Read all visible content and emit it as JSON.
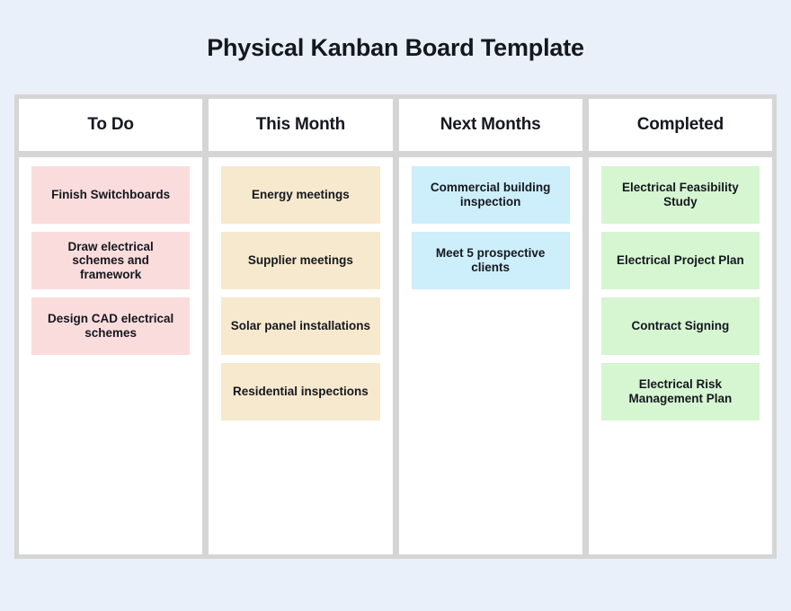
{
  "page": {
    "background_color": "#eaf0fa",
    "title": "Physical Kanban Board Template"
  },
  "board": {
    "frame_color": "#d5d5d5",
    "panel_color": "#ffffff",
    "columns": [
      {
        "header": "To Do",
        "card_color": "#fbdcdc",
        "cards": [
          {
            "label": "Finish Switchboards"
          },
          {
            "label": "Draw electrical schemes and framework"
          },
          {
            "label": "Design CAD electrical schemes"
          }
        ]
      },
      {
        "header": "This Month",
        "card_color": "#f7e9cd",
        "cards": [
          {
            "label": "Energy meetings"
          },
          {
            "label": "Supplier meetings"
          },
          {
            "label": "Solar panel installations"
          },
          {
            "label": "Residential inspections"
          }
        ]
      },
      {
        "header": "Next Months",
        "card_color": "#cdeefb",
        "cards": [
          {
            "label": "Commercial building inspection"
          },
          {
            "label": "Meet 5 prospective clients"
          }
        ]
      },
      {
        "header": "Completed",
        "card_color": "#d6f5d1",
        "cards": [
          {
            "label": "Electrical Feasibility Study"
          },
          {
            "label": "Electrical Project Plan"
          },
          {
            "label": "Contract Signing"
          },
          {
            "label": "Electrical Risk Management Plan"
          }
        ]
      }
    ]
  }
}
